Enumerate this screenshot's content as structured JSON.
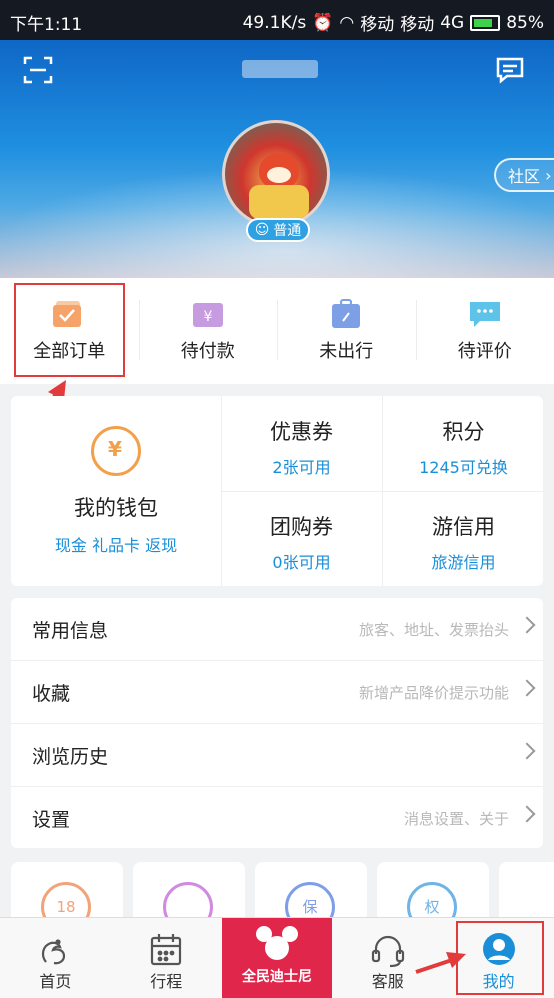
{
  "status_bar": {
    "time": "下午1:11",
    "speed": "49.1K/s",
    "carrier1": "移动",
    "carrier2": "移动",
    "network": "4G",
    "battery": "85%"
  },
  "header": {
    "community_label": "社区",
    "level_badge": "普通"
  },
  "orders": [
    {
      "label": "全部订单",
      "icon": "order-icon"
    },
    {
      "label": "待付款",
      "icon": "wallet-yen-icon"
    },
    {
      "label": "未出行",
      "icon": "suitcase-icon"
    },
    {
      "label": "待评价",
      "icon": "comment-icon"
    }
  ],
  "wallet": {
    "title": "我的钱包",
    "links": "现金  礼品卡  返现",
    "cells": [
      {
        "title": "优惠券",
        "sub": "2张可用"
      },
      {
        "title": "积分",
        "sub": "1245可兑换"
      },
      {
        "title": "团购券",
        "sub": "0张可用"
      },
      {
        "title": "游信用",
        "sub": "旅游信用"
      }
    ]
  },
  "menu": [
    {
      "title": "常用信息",
      "hint": "旅客、地址、发票抬头"
    },
    {
      "title": "收藏",
      "hint": "新增产品降价提示功能"
    },
    {
      "title": "浏览历史",
      "hint": ""
    },
    {
      "title": "设置",
      "hint": "消息设置、关于"
    }
  ],
  "partial_cards": [
    "18",
    "",
    "保",
    "权"
  ],
  "tabbar": [
    {
      "label": "首页",
      "icon": "home-icon"
    },
    {
      "label": "行程",
      "icon": "calendar-icon"
    },
    {
      "label": "全民迪士尼",
      "icon": "mickey-icon"
    },
    {
      "label": "客服",
      "icon": "headset-icon"
    },
    {
      "label": "我的",
      "icon": "profile-icon"
    }
  ],
  "colors": {
    "accent": "#1a8fd8",
    "highlight": "#e23b3b",
    "disney": "#e0274b"
  }
}
